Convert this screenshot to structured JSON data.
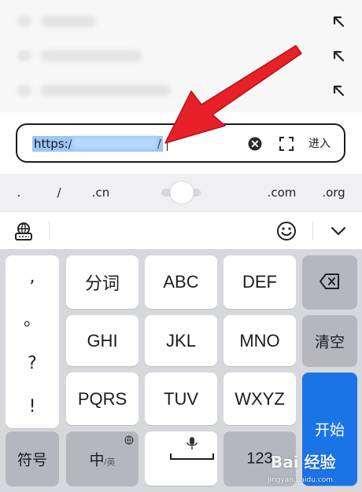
{
  "suggestions": [
    {
      "arrow_icon": "arrow-up-left-icon"
    },
    {
      "arrow_icon": "arrow-up-left-icon"
    },
    {
      "arrow_icon": "arrow-up-left-icon"
    }
  ],
  "url_bar": {
    "value_visible": "https:/",
    "value_end": "/",
    "clear_icon": "close-circle-icon",
    "expand_icon": "fullscreen-icon",
    "enter_label": "进入"
  },
  "quick_symbols": [
    ".",
    "/",
    ".cn",
    ".com",
    ".org"
  ],
  "toolbar": {
    "keyboard_settings_icon": "keyboard-globe-icon",
    "emoji_icon": "emoji-icon",
    "collapse_icon": "chevron-down-icon"
  },
  "keyboard": {
    "punctuation": [
      ",",
      "。",
      "?",
      "!"
    ],
    "row1": [
      "分词",
      "ABC",
      "DEF"
    ],
    "row2": [
      "GHI",
      "JKL",
      "MNO"
    ],
    "row3": [
      "PQRS",
      "TUV",
      "WXYZ"
    ],
    "backspace_icon": "backspace-icon",
    "clear_label": "清空",
    "start_label": "开始",
    "symbols_label": "符号",
    "lang_main": "中",
    "lang_sub": "/英",
    "number_label": "123"
  },
  "watermark": {
    "main": "Bai 经验",
    "sub": "jingyan.baidu.com"
  },
  "colors": {
    "accent_blue": "#1a74e6",
    "selection": "#9cc6f6",
    "annotation_red": "#e8202a"
  }
}
